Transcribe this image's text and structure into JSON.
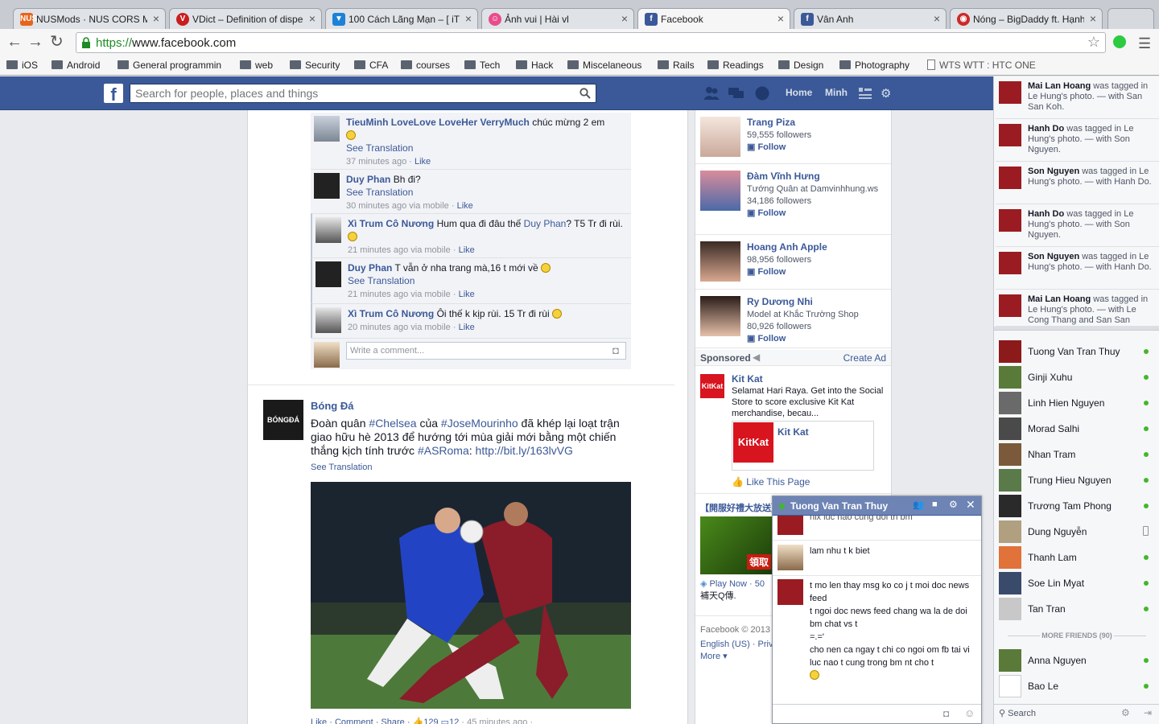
{
  "browser": {
    "tabs": [
      {
        "title": "NUSMods · NUS CORS Mod",
        "fav_color": "#e8641b",
        "fav_text": "NUS"
      },
      {
        "title": "VDict – Definition of dispe",
        "fav_color": "#c91e1e",
        "fav_text": "V"
      },
      {
        "title": "100 Cách Lãng Mạn – [ iT ]",
        "fav_color": "#1c82d8",
        "fav_text": "▼"
      },
      {
        "title": "Ảnh vui | Hài vl",
        "fav_color": "#e84c8c",
        "fav_text": "☺"
      },
      {
        "title": "Facebook",
        "fav_color": "#3b5998",
        "fav_text": "f"
      },
      {
        "title": "Vân Anh",
        "fav_color": "#3b5998",
        "fav_text": "f"
      },
      {
        "title": "Nóng – BigDaddy ft. Hạnh",
        "fav_color": "#cc2a2a",
        "fav_text": "◉"
      }
    ],
    "url_scheme": "https://",
    "url_host": "www.facebook.com",
    "bookmarks": [
      "iOS",
      "Android",
      "General programmin",
      "web",
      "Security",
      "CFA",
      "courses",
      "Tech",
      "Hack",
      "Miscelaneous",
      "Rails",
      "Readings",
      "Design",
      "Photography",
      "WTS WTT : HTC ONE"
    ]
  },
  "header": {
    "search_placeholder": "Search for people, places and things",
    "nav_home": "Home",
    "nav_profile": "Minh"
  },
  "comments": [
    {
      "name": "TieuMinh LoveLove LoveHer VerryMuch",
      "text": "chúc mừng 2 em",
      "see_translation": "See Translation",
      "meta": "37 minutes ago · ",
      "like": "Like"
    },
    {
      "name": "Duy Phan",
      "text": "Bh đi?",
      "see_translation": "See Translation",
      "meta": "30 minutes ago via mobile · ",
      "like": "Like"
    },
    {
      "name": "Xì Trum Cô Nương",
      "text": "Hum qua đi đâu thế ",
      "mention": "Duy Phan",
      "text2": "? T5 Tr đi rùi.",
      "meta": "21 minutes ago via mobile · ",
      "like": "Like"
    },
    {
      "name": "Duy Phan",
      "text": "T vẫn ở nha trang mà,16 t mới về",
      "see_translation": "See Translation",
      "meta": "21 minutes ago via mobile · ",
      "like": "Like"
    },
    {
      "name": "Xì Trum Cô Nương",
      "text": "Ôi thế k kịp rùi. 15 Tr đi rùi",
      "meta": "20 minutes ago via mobile · ",
      "like": "Like"
    }
  ],
  "write_comment_placeholder": "Write a comment...",
  "post": {
    "author": "Bóng Đá",
    "avatar_text": "BÓNGĐÁ",
    "text_a": "Đoàn quân ",
    "tag1": "#Chelsea",
    "text_b": " của ",
    "tag2": "#JoseMourinho",
    "text_c": " đã khép lại loạt trận giao hữu hè 2013 để hướng tới mùa giải mới bằng một chiến thắng kịch tính trước ",
    "tag3": "#ASRoma",
    "text_d": ": ",
    "link": "http://bit.ly/163lvVG",
    "see_translation": "See Translation",
    "footer": "Like · Comment · Share · ",
    "likes": "129",
    "comments_count": "12",
    "time": " · 45 minutes ago · "
  },
  "suggestions": [
    {
      "name": "Trang Piza",
      "desc": "",
      "followers": "59,555 followers",
      "follow": "Follow"
    },
    {
      "name": "Đàm Vĩnh Hưng",
      "desc": "Tướng Quân at Damvinhhung.ws",
      "followers": "34,186 followers",
      "follow": "Follow"
    },
    {
      "name": "Hoang Anh Apple",
      "desc": "",
      "followers": "98,956 followers",
      "follow": "Follow"
    },
    {
      "name": "Ry Dương Nhi",
      "desc": "Model at Khắc Trường Shop",
      "followers": "80,926 followers",
      "follow": "Follow"
    }
  ],
  "sponsored": {
    "label": "Sponsored",
    "create_ad": "Create Ad",
    "ad_title": "Kit Kat",
    "ad_text": "Selamat Hari Raya. Get into the Social Store to score exclusive Kit Kat merchandise, becau...",
    "page_name": "Kit Kat",
    "like_page": "Like This Page",
    "ad2_title": "【開服好禮大放送】",
    "ad2_play": "Play Now · 50",
    "ad2_text": "補天Q傳."
  },
  "footer": {
    "copyright": "Facebook © 2013",
    "lang": "English (US) · Priv",
    "more": "More ▾"
  },
  "ticker": [
    {
      "actor": "Mai Lan Hoang",
      "text": " was tagged in Le Hung's photo. — with San San Koh."
    },
    {
      "actor": "Hanh Do",
      "text": " was tagged in Le Hung's photo. — with Son Nguyen."
    },
    {
      "actor": "Son Nguyen",
      "text": " was tagged in Le Hung's photo. — with Hanh Do."
    },
    {
      "actor": "Hanh Do",
      "text": " was tagged in Le Hung's photo. — with Son Nguyen."
    },
    {
      "actor": "Son Nguyen",
      "text": " was tagged in Le Hung's photo. — with Hanh Do."
    },
    {
      "actor": "Mai Lan Hoang",
      "text": " was tagged in Le Hung's photo. — with Le Cong Thang and San San"
    }
  ],
  "friends": [
    {
      "name": "Tuong Van Tran Thuy",
      "status": "online"
    },
    {
      "name": "Ginji Xuhu",
      "status": "online"
    },
    {
      "name": "Linh Hien Nguyen",
      "status": "online"
    },
    {
      "name": "Morad Salhi",
      "status": "online"
    },
    {
      "name": "Nhan Tram",
      "status": "online"
    },
    {
      "name": "Trung Hieu Nguyen",
      "status": "online"
    },
    {
      "name": "Trương Tam Phong",
      "status": "online"
    },
    {
      "name": "Dung Nguyễn",
      "status": "mobile"
    },
    {
      "name": "Thanh Lam",
      "status": "online"
    },
    {
      "name": "Soe Lin Myat",
      "status": "online"
    },
    {
      "name": "Tan Tran",
      "status": "online"
    }
  ],
  "more_friends": "MORE FRIENDS (90)",
  "more_friends_list": [
    {
      "name": "Anna Nguyen",
      "status": "online"
    },
    {
      "name": "Bao Le",
      "status": "online"
    }
  ],
  "sidebar_search": "Search",
  "chat": {
    "name": "Tuong Van Tran Thuy",
    "partial": "nix luc nao cung doi th bm",
    "msg1": "lam nhu t k biet",
    "msgs": [
      "t mo len thay msg ko co j t moi doc news feed",
      "t ngoi doc news feed chang wa la de doi bm chat vs t",
      "=.='",
      "cho nen ca ngay t chi co ngoi om fb tai vi luc nao t cung trong bm nt cho t"
    ]
  }
}
